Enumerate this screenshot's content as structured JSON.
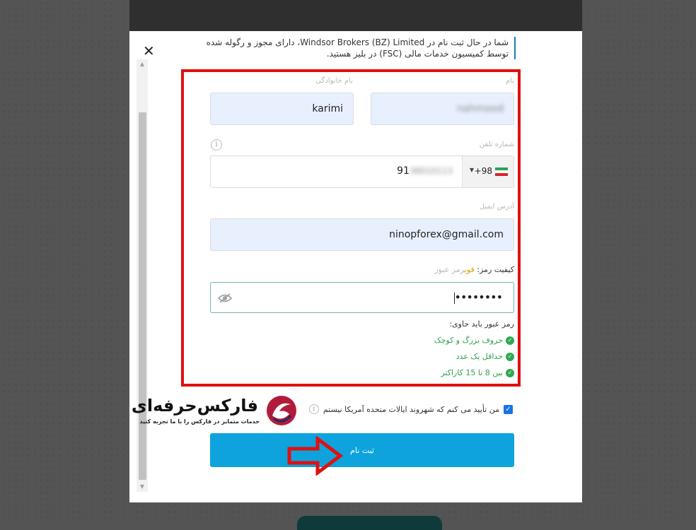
{
  "modal": {
    "close_label": "✕",
    "intro_line1": "شما در حال ثبت نام در Windsor Brokers (BZ) Limited، دارای مجوز و رگوله شده",
    "intro_line2": "توسط کمیسیون خدمات مالی (FSC) در بلیز هستید."
  },
  "form": {
    "first_name_label": "نام",
    "first_name_value": "nahmood",
    "last_name_label": "نام خانوادگی",
    "last_name_value": "karimi",
    "phone_label": "شماره تلفن",
    "phone_dial_code": "+98",
    "phone_number_visible": "91",
    "phone_number_hidden": "38010113",
    "email_label": "آدرس ایمیل",
    "email_value": "ninopforex@gmail.com",
    "password_strength_label": "کیفیت رمز:",
    "password_strength_value": "قوی",
    "password_label": "رمز عبور",
    "password_value": "••••••••",
    "rules_title": "رمز عبور باید حاوی:",
    "rules": [
      "حروف بزرگ و کوچک",
      "حداقل یک عدد",
      "بین 8 تا 15 کاراکتر"
    ],
    "us_confirm_label": "من تأیید می کنم که شهروند ایالات متحده آمریکا نیستم",
    "submit_label": "ثبت نام"
  },
  "logo": {
    "title": "فارکس‌حرفه‌ای",
    "subtitle": "خدمات متمایز در فارکس را با ما تجربه کنید"
  },
  "colors": {
    "accent": "#0ea3dc",
    "highlight": "#e01010",
    "success": "#2eaa52"
  }
}
